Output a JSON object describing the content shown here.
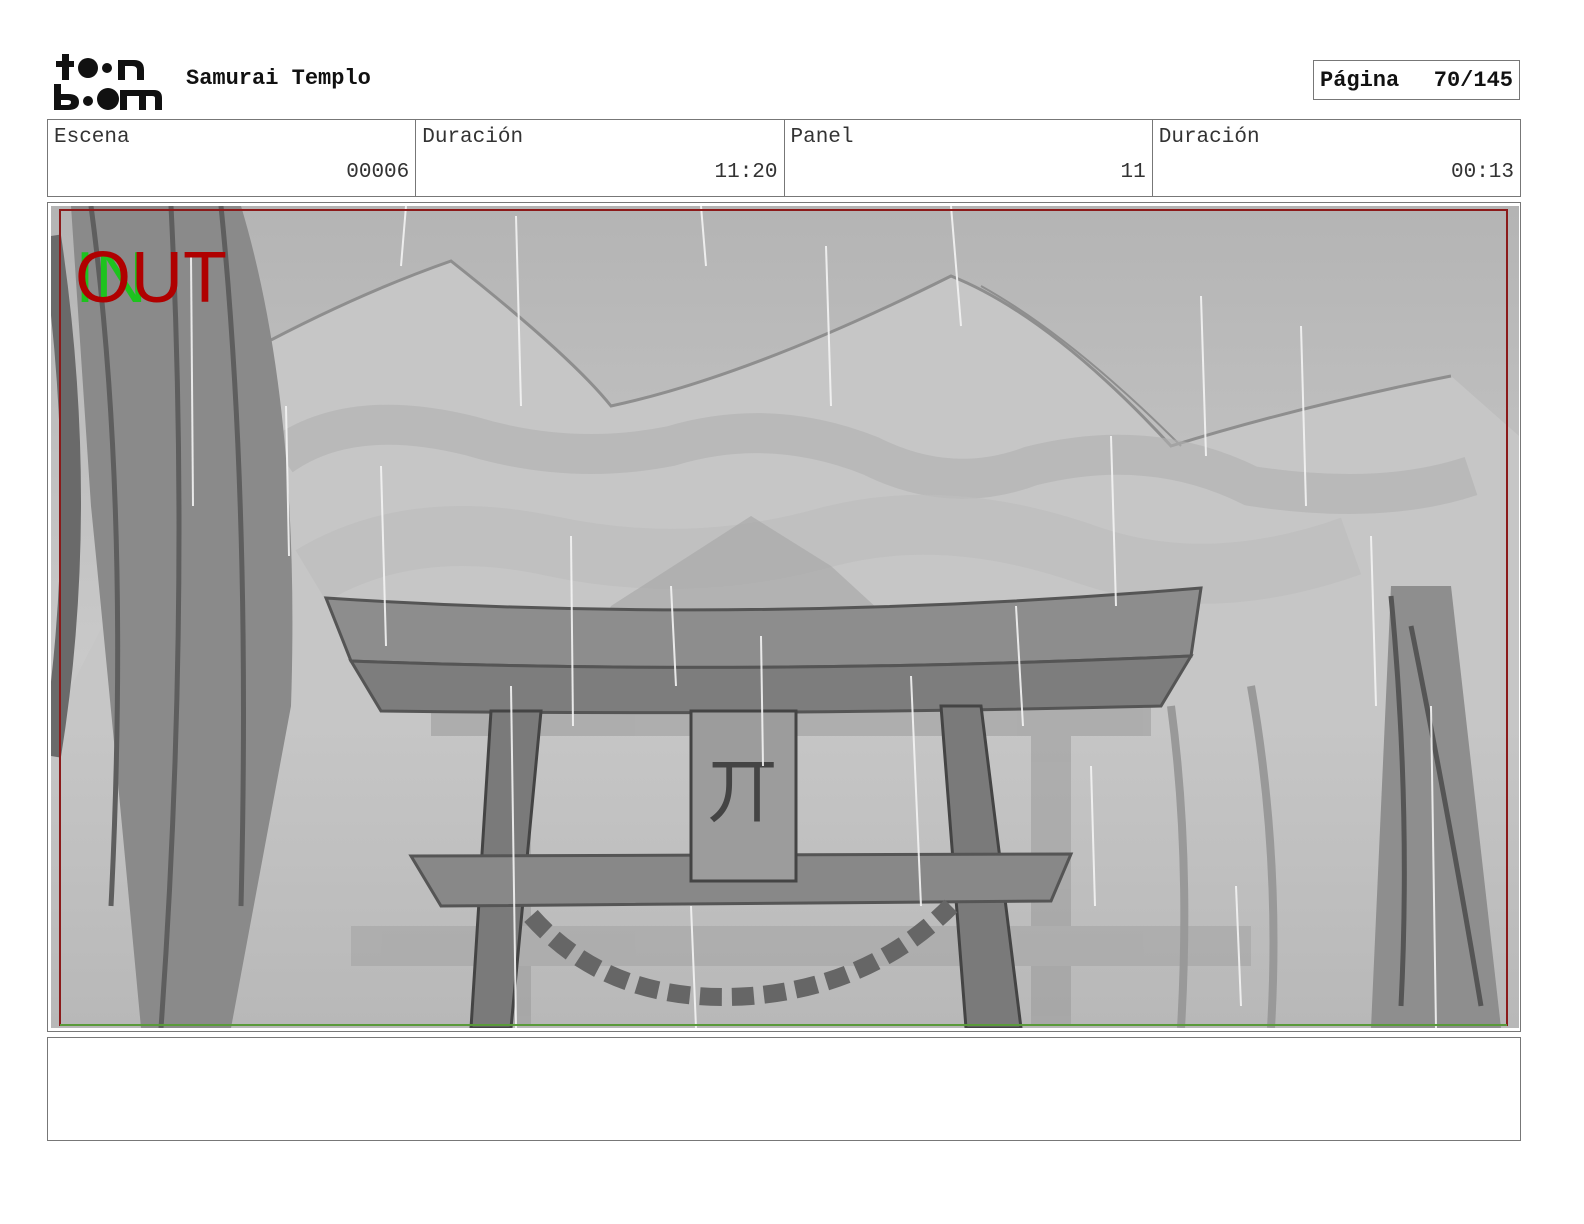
{
  "header": {
    "logo_alt": "toon boom",
    "project_title": "Samurai Templo",
    "page_label": "Página",
    "page_value": "70/145"
  },
  "info": {
    "scene_label": "Escena",
    "scene_value": "00006",
    "scene_duration_label": "Duración",
    "scene_duration_value": "11:20",
    "panel_label": "Panel",
    "panel_value": "11",
    "panel_duration_label": "Duración",
    "panel_duration_value": "00:13"
  },
  "panel": {
    "in_marker": "IN",
    "out_marker": "OUT",
    "in_color": "#1ec31e",
    "out_color": "#b00000",
    "frame_color": "#8b1a1a",
    "sign_glyph": "丌"
  },
  "notes": {
    "text": ""
  }
}
